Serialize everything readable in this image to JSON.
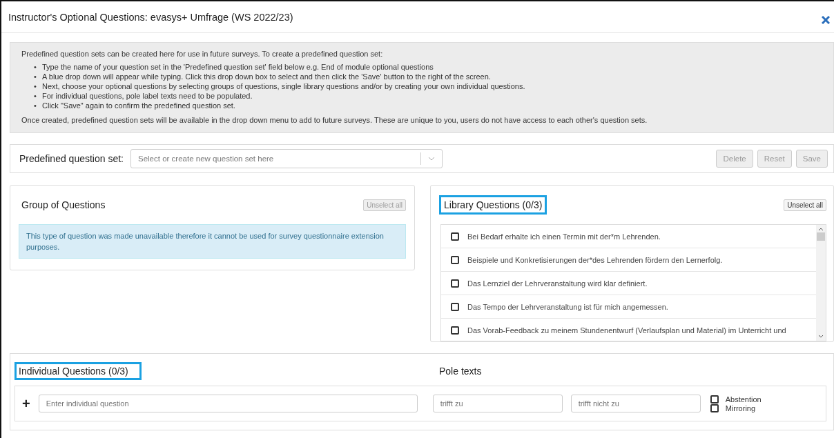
{
  "window": {
    "title": "Instructor's Optional Questions: evasys+ Umfrage (WS 2022/23)"
  },
  "info": {
    "intro": "Predefined question sets can be created here for use in future surveys. To create a predefined question set:",
    "bullet": "•",
    "steps": [
      "Type the name of your question set in the 'Predefined question set' field below e.g. End of module optional questions",
      "A blue drop down will appear while typing. Click this drop down box to select and then click the 'Save' button to the right of the screen.",
      "Next, choose your optional questions by selecting groups of questions, single library questions and/or by creating your own individual questions.",
      "For individual questions, pole label texts need to be populated.",
      "Click \"Save\" again to confirm the predefined question set."
    ],
    "outro": "Once created, predefined question sets will be available in the drop down menu to add to future surveys. These are unique to you, users do not have access to each other's question sets."
  },
  "question_set": {
    "label": "Predefined question set:",
    "placeholder": "Select or create new question set here",
    "buttons": [
      {
        "label": "Delete",
        "disabled": true
      },
      {
        "label": "Reset",
        "disabled": true
      },
      {
        "label": "Save",
        "disabled": true
      }
    ]
  },
  "group_of_questions": {
    "title": "Group of Questions",
    "unselect": "Unselect all",
    "notice": "This type of question was made unavailable therefore it cannot be used for survey questionnaire extension purposes."
  },
  "library_questions": {
    "title": "Library Questions (0/3)",
    "highlighted": true,
    "unselect": "Unselect all",
    "items": [
      {
        "text": "Bei Bedarf erhalte ich einen Termin mit der*m Lehrenden.",
        "checked": false
      },
      {
        "text": "Beispiele und Konkretisierungen der*des Lehrenden fördern den Lernerfolg.",
        "checked": false
      },
      {
        "text": "Das Lernziel der Lehrveranstaltung wird klar definiert.",
        "checked": false
      },
      {
        "text": "Das Tempo der Lehrveranstaltung ist für mich angemessen.",
        "checked": false
      },
      {
        "text": "Das Vorab-Feedback zu meinem Stundenentwurf (Verlaufsplan und Material) im Unterricht und",
        "checked": false
      }
    ]
  },
  "individual_questions": {
    "title": "Individual Questions (0/3)",
    "highlighted": true,
    "pole_texts_title": "Pole texts",
    "add": "+",
    "question_placeholder": "Enter individual question",
    "pole_left_placeholder": "trifft zu",
    "pole_right_placeholder": "trifft nicht zu",
    "options": [
      {
        "label": "Abstention",
        "checked": false
      },
      {
        "label": "Mirroring",
        "checked": false
      }
    ]
  }
}
